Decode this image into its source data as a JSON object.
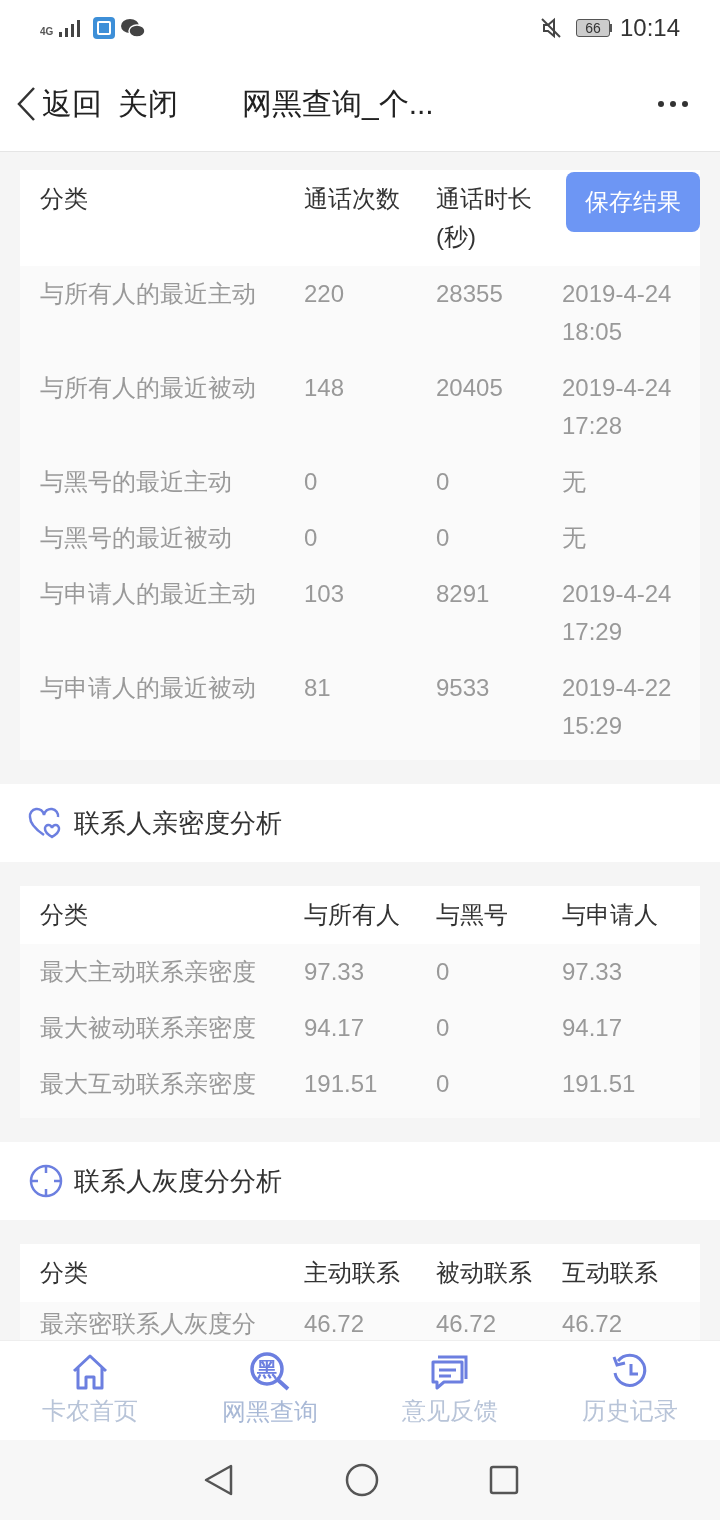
{
  "status_bar": {
    "network": "4G",
    "battery": "66",
    "time": "10:14"
  },
  "header": {
    "back": "返回",
    "close": "关闭",
    "title": "网黑查询_个..."
  },
  "save_button": "保存结果",
  "sections": [
    {
      "table": {
        "columns": [
          "分类",
          "通话次数",
          "通话时长\n(秒)",
          ""
        ],
        "rows": [
          [
            "与所有人的最近主动",
            "220",
            "28355",
            "2019-4-24\n18:05"
          ],
          [
            "与所有人的最近被动",
            "148",
            "20405",
            "2019-4-24\n17:28"
          ],
          [
            "与黑号的最近主动",
            "0",
            "0",
            "无"
          ],
          [
            "与黑号的最近被动",
            "0",
            "0",
            "无"
          ],
          [
            "与申请人的最近主动",
            "103",
            "8291",
            "2019-4-24\n17:29"
          ],
          [
            "与申请人的最近被动",
            "81",
            "9533",
            "2019-4-22\n15:29"
          ]
        ]
      }
    },
    {
      "title": "联系人亲密度分析",
      "table": {
        "columns": [
          "分类",
          "与所有人",
          "与黑号",
          "与申请人"
        ],
        "rows": [
          [
            "最大主动联系亲密度",
            "97.33",
            "0",
            "97.33"
          ],
          [
            "最大被动联系亲密度",
            "94.17",
            "0",
            "94.17"
          ],
          [
            "最大互动联系亲密度",
            "191.51",
            "0",
            "191.51"
          ]
        ]
      }
    },
    {
      "title": "联系人灰度分分析",
      "table": {
        "columns": [
          "分类",
          "主动联系",
          "被动联系",
          "互动联系"
        ],
        "rows": [
          [
            "最亲密联系人灰度分",
            "46.72",
            "46.72",
            "46.72"
          ]
        ]
      }
    }
  ],
  "bottom_nav": [
    {
      "label": "卡农首页",
      "selected": false
    },
    {
      "label": "网黑查询",
      "icon_text": "黑",
      "selected": true
    },
    {
      "label": "意见反馈",
      "selected": false
    },
    {
      "label": "历史记录",
      "selected": false
    }
  ]
}
